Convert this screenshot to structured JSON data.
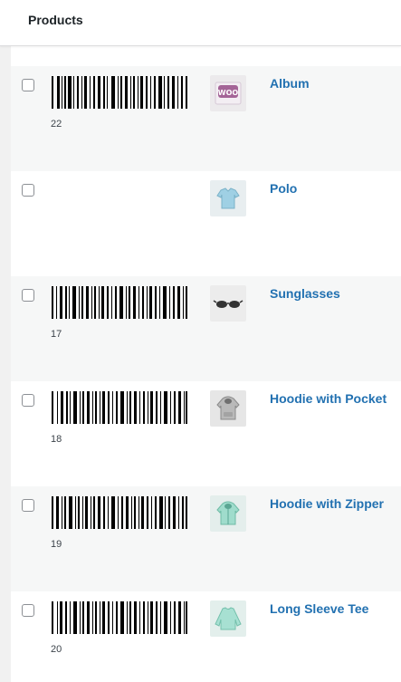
{
  "header": {
    "title": "Products"
  },
  "rows": [
    {
      "name": "Album",
      "sku": "22",
      "has_barcode": true,
      "thumb_icon": "woo-album-icon"
    },
    {
      "name": "Polo",
      "sku": "",
      "has_barcode": false,
      "thumb_icon": "polo-shirt-icon"
    },
    {
      "name": "Sunglasses",
      "sku": "17",
      "has_barcode": true,
      "thumb_icon": "sunglasses-icon"
    },
    {
      "name": "Hoodie with Pocket",
      "sku": "18",
      "has_barcode": true,
      "thumb_icon": "hoodie-icon"
    },
    {
      "name": "Hoodie with Zipper",
      "sku": "19",
      "has_barcode": true,
      "thumb_icon": "hoodie-zipper-icon"
    },
    {
      "name": "Long Sleeve Tee",
      "sku": "20",
      "has_barcode": true,
      "thumb_icon": "long-sleeve-tee-icon"
    }
  ],
  "colors": {
    "link": "#2271b1",
    "row_alt": "#f6f7f7",
    "text": "#3c434a"
  }
}
